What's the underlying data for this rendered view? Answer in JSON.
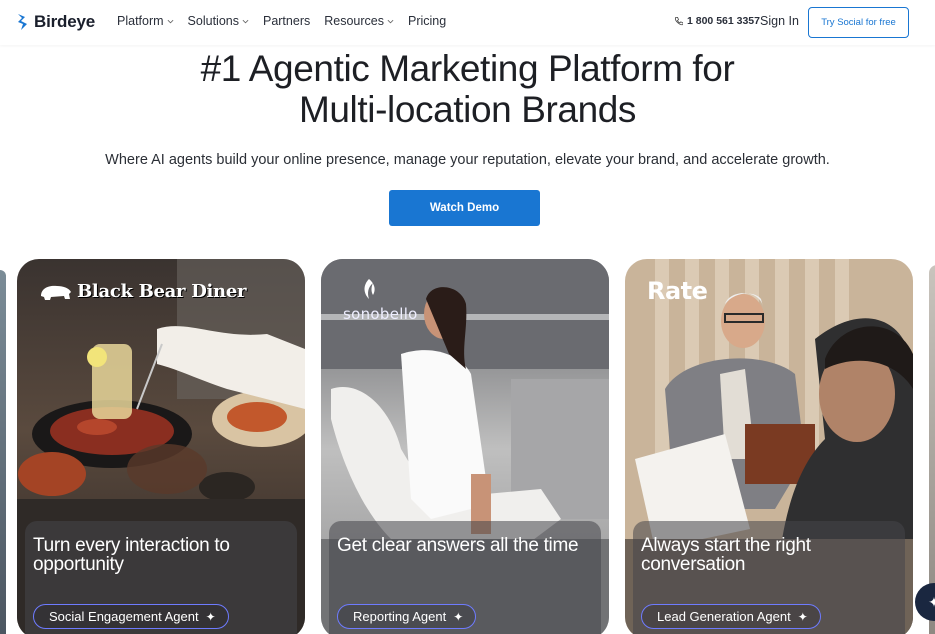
{
  "nav": {
    "logo": "Birdeye",
    "menu": [
      {
        "label": "Platform",
        "has_caret": true
      },
      {
        "label": "Solutions",
        "has_caret": true
      },
      {
        "label": "Partners",
        "has_caret": false
      },
      {
        "label": "Resources",
        "has_caret": true
      },
      {
        "label": "Pricing",
        "has_caret": false
      }
    ],
    "phone": "1 800 561 3357",
    "sign_in": "Sign In",
    "cta": "Try Social for free"
  },
  "hero": {
    "headline_line1": "#1 Agentic Marketing Platform for",
    "headline_line2": "Multi-location Brands",
    "subheadline": "Where AI agents build your online presence, manage your reputation, elevate your brand, and accelerate growth.",
    "button": "Watch Demo"
  },
  "cards": [
    {
      "brand": "Black Bear Diner",
      "title": "Turn every interaction to opportunity",
      "agent": "Social Engagement Agent"
    },
    {
      "brand": "sonobello",
      "title": "Get clear answers all the time",
      "agent": "Reporting Agent"
    },
    {
      "brand": "Rate",
      "title": "Always start the right conversation",
      "agent": "Lead Generation Agent"
    }
  ],
  "colors": {
    "primary": "#1976d2",
    "pill_border": "#6e7bff",
    "text_dark": "#1d1f24"
  },
  "icons": [
    "phone-icon",
    "sparkle-icon",
    "chevron-down-icon",
    "chat-icon"
  ]
}
